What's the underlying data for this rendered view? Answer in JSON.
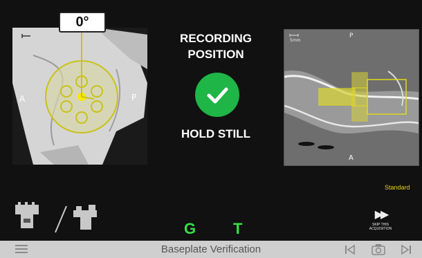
{
  "screen": {
    "angle": "0°",
    "left_view": {
      "label_a": "A",
      "label_p": "P"
    },
    "status": {
      "line1": "RECORDING",
      "line2": "POSITION",
      "hold": "HOLD STILL"
    },
    "right_view": {
      "scale": "5mm",
      "label_p": "P",
      "label_a": "A"
    },
    "standard_label": "Standard",
    "indicators": {
      "g": "G",
      "t": "T"
    },
    "skip": {
      "line1": "SKIP THIS",
      "line2": "ACQUISITION"
    }
  },
  "bottom_bar": {
    "title": "Baseplate Verification"
  },
  "colors": {
    "accent_green": "#38e043",
    "check_green": "#1fb547",
    "overlay_yellow": "#e8d21c"
  },
  "icons": [
    "menu-icon",
    "check-icon",
    "fast-forward-icon",
    "skip-back-icon",
    "camera-icon",
    "skip-forward-icon"
  ]
}
